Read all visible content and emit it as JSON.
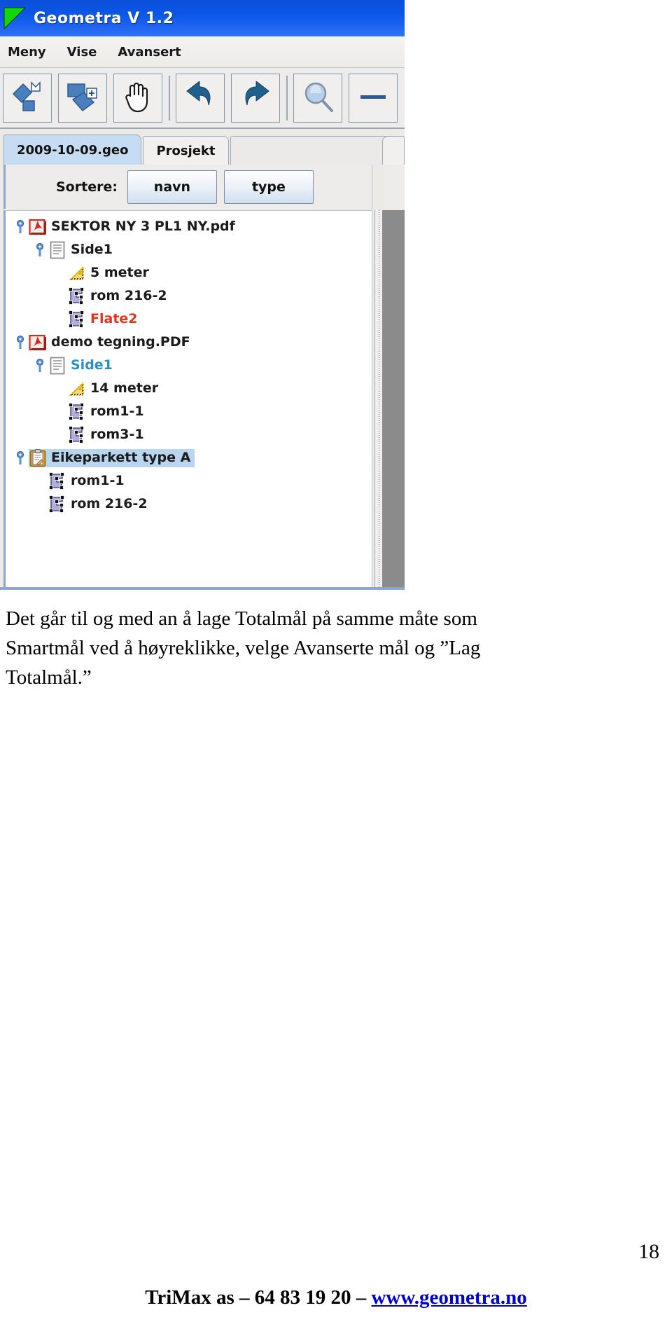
{
  "app": {
    "title": "Geometra V 1.2",
    "logo_icon": "green-triangle-logo",
    "menubar": [
      {
        "label": "Meny"
      },
      {
        "label": "Vise"
      },
      {
        "label": "Avansert"
      }
    ],
    "toolbar": [
      {
        "icon": "new-shape-icon",
        "tooltip": "Ny form"
      },
      {
        "icon": "add-shape-icon",
        "tooltip": "Legg til form"
      },
      {
        "icon": "pan-hand-icon",
        "tooltip": "Panorer"
      },
      {
        "separator": true
      },
      {
        "icon": "undo-arrow-icon",
        "tooltip": "Angre"
      },
      {
        "icon": "redo-arrow-icon",
        "tooltip": "Gjenta"
      },
      {
        "separator": true
      },
      {
        "icon": "magnifier-icon",
        "tooltip": "Zoom"
      },
      {
        "icon": "minus-icon",
        "tooltip": "Zoom ut"
      }
    ],
    "tabs": [
      {
        "label": "2009-10-09.geo",
        "active": true
      },
      {
        "label": "Prosjekt",
        "active": false
      }
    ],
    "sort": {
      "label": "Sortere:",
      "buttons": [
        {
          "label": "navn"
        },
        {
          "label": "type"
        }
      ]
    },
    "tree": [
      {
        "label": "SEKTOR NY 3 PL1 NY.pdf",
        "icon": "pdf-file-icon",
        "handle": "expanded-key-handle",
        "indent": 0,
        "color": "#1b1b1b",
        "selected": false
      },
      {
        "label": "Side1",
        "icon": "page-sheet-icon",
        "handle": "expanded-key-handle",
        "indent": 1,
        "color": "#1b1b1b",
        "selected": false
      },
      {
        "label": "5 meter",
        "icon": "yellow-triangle-measure-icon",
        "handle": "none",
        "indent": 2,
        "color": "#1b1b1b",
        "selected": false
      },
      {
        "label": "rom 216-2",
        "icon": "room-polygon-icon",
        "handle": "none",
        "indent": 2,
        "color": "#1b1b1b",
        "selected": false
      },
      {
        "label": "Flate2",
        "icon": "room-polygon-icon",
        "handle": "none",
        "indent": 2,
        "color": "#e8321c",
        "selected": false
      },
      {
        "label": "demo tegning.PDF",
        "icon": "pdf-file-icon",
        "handle": "expanded-key-handle",
        "indent": 0,
        "color": "#1b1b1b",
        "selected": false
      },
      {
        "label": "Side1",
        "icon": "page-sheet-icon",
        "handle": "expanded-key-handle",
        "indent": 1,
        "color": "#2a8fc4",
        "selected": false
      },
      {
        "label": "14 meter",
        "icon": "yellow-triangle-measure-icon",
        "handle": "none",
        "indent": 2,
        "color": "#1b1b1b",
        "selected": false
      },
      {
        "label": "rom1-1",
        "icon": "room-polygon-icon",
        "handle": "none",
        "indent": 2,
        "color": "#1b1b1b",
        "selected": false
      },
      {
        "label": "rom3-1",
        "icon": "room-polygon-icon",
        "handle": "none",
        "indent": 2,
        "color": "#1b1b1b",
        "selected": false
      },
      {
        "label": "Eikeparkett type A",
        "icon": "clipboard-icon",
        "handle": "expanded-key-handle",
        "indent": 0,
        "color": "#1b1b1b",
        "selected": true
      },
      {
        "label": "rom1-1",
        "icon": "room-polygon-icon",
        "handle": "none",
        "indent": 1,
        "color": "#1b1b1b",
        "selected": false
      },
      {
        "label": "rom 216-2",
        "icon": "room-polygon-icon",
        "handle": "none",
        "indent": 1,
        "color": "#1b1b1b",
        "selected": false
      }
    ],
    "colors": {
      "titlebar": "#0d56e8",
      "tab_active": "#c6dcf2",
      "selection": "#b8d6ef",
      "accent_border": "#8ea6cb",
      "flate2_text": "#e8321c",
      "side1_blue_text": "#2a8fc4"
    }
  },
  "document": {
    "paragraph": "Det går til og med an å lage Totalmål på samme måte som Smartmål ved å høyreklikke, velge Avanserte mål og ”Lag Totalmål.”",
    "page_number": "18",
    "footer_prefix": "TriMax as – 64 83 19 20 – ",
    "footer_link": "www.geometra.no"
  }
}
